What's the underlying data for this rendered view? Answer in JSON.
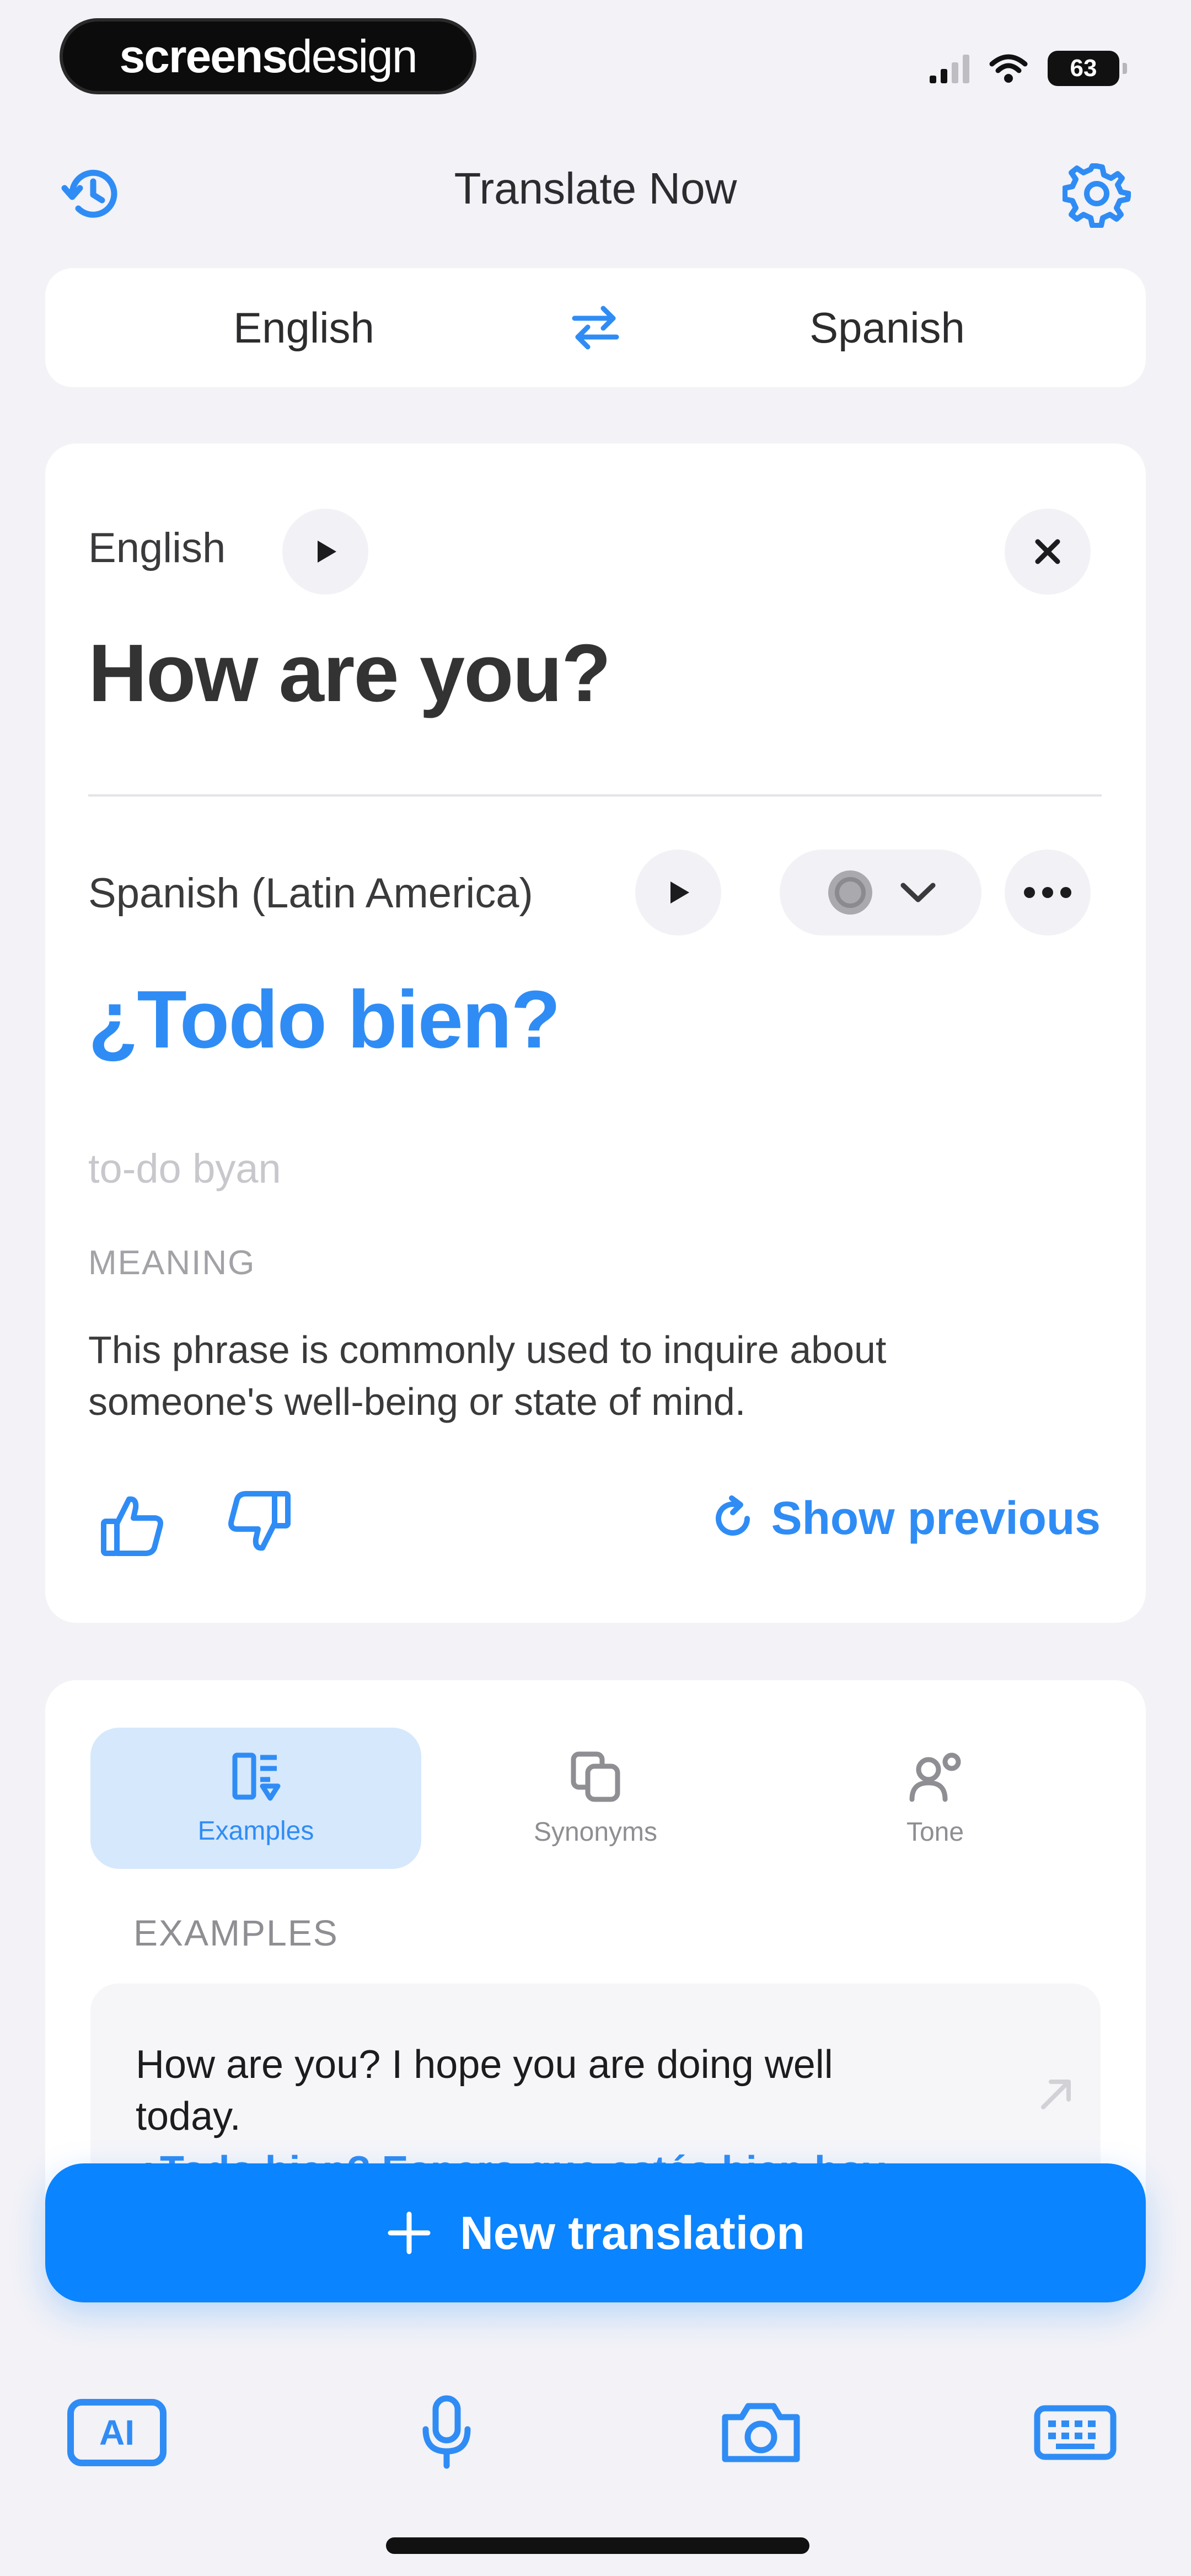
{
  "status_bar": {
    "brand_bold": "screens",
    "brand_light": "design",
    "battery": "63"
  },
  "header": {
    "title": "Translate Now",
    "history_icon": "history-icon",
    "settings_icon": "gear-icon"
  },
  "languages": {
    "source": "English",
    "target": "Spanish",
    "swap_icon": "swap-arrows-icon"
  },
  "source": {
    "language": "English",
    "text": "How are you?"
  },
  "result": {
    "language": "Spanish (Latin America)",
    "text": "¿Todo bien?",
    "transliteration": "to-do byan",
    "meaning_heading": "MEANING",
    "meaning": "This phrase is commonly used to inquire about someone's well-being or state of mind.",
    "show_previous": "Show previous"
  },
  "tabs": [
    {
      "label": "Examples",
      "active": true
    },
    {
      "label": "Synonyms",
      "active": false
    },
    {
      "label": "Tone",
      "active": false
    }
  ],
  "examples": {
    "heading": "EXAMPLES",
    "items": [
      {
        "en": "How are you? I hope you are doing well today.",
        "es": "¿Todo bien? Espero que estés bien hoy."
      }
    ]
  },
  "new_translation": "New translation",
  "bottom_bar": {
    "ai_label": "AI"
  },
  "colors": {
    "accent": "#0a84ff",
    "text_blue": "#2f8cf5",
    "background": "#f2f2f7"
  }
}
